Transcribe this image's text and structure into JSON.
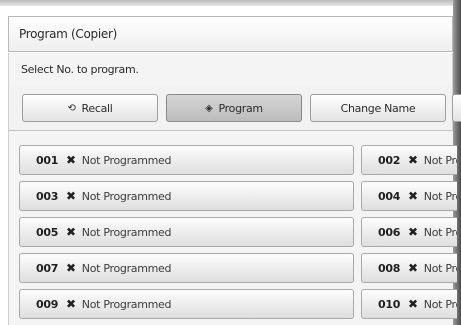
{
  "window": {
    "title": "Program (Copier)"
  },
  "instruction": "Select No. to program.",
  "tabs": [
    {
      "label": "Recall",
      "icon": "recall-icon",
      "glyph": "⟲",
      "active": false
    },
    {
      "label": "Program",
      "icon": "program-icon",
      "glyph": "◈",
      "active": true
    },
    {
      "label": "Change Name",
      "active": false
    }
  ],
  "programs": {
    "mark": "✖",
    "left": [
      {
        "number": "001",
        "status": "Not Programmed"
      },
      {
        "number": "003",
        "status": "Not Programmed"
      },
      {
        "number": "005",
        "status": "Not Programmed"
      },
      {
        "number": "007",
        "status": "Not Programmed"
      },
      {
        "number": "009",
        "status": "Not Programmed"
      }
    ],
    "right": [
      {
        "number": "002",
        "status": "Not Programmed"
      },
      {
        "number": "004",
        "status": "Not Programmed"
      },
      {
        "number": "006",
        "status": "Not Programmed"
      },
      {
        "number": "008",
        "status": "Not Programmed"
      },
      {
        "number": "010",
        "status": "Not Programmed"
      }
    ]
  }
}
